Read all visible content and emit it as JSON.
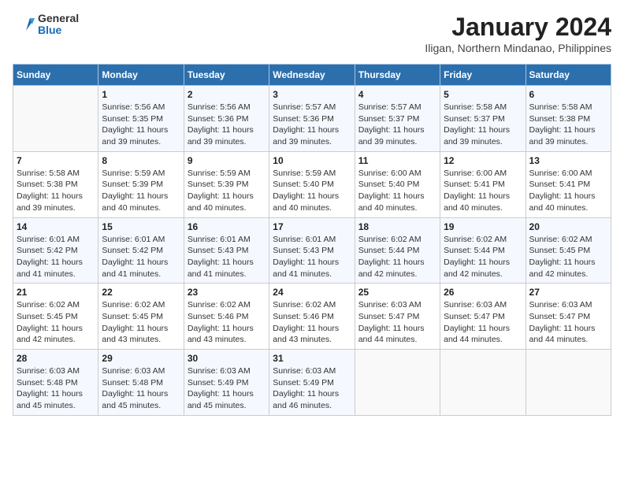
{
  "header": {
    "logo_general": "General",
    "logo_blue": "Blue",
    "month_title": "January 2024",
    "location": "Iligan, Northern Mindanao, Philippines"
  },
  "days_of_week": [
    "Sunday",
    "Monday",
    "Tuesday",
    "Wednesday",
    "Thursday",
    "Friday",
    "Saturday"
  ],
  "weeks": [
    [
      {
        "day": "",
        "sunrise": "",
        "sunset": "",
        "daylight": ""
      },
      {
        "day": "1",
        "sunrise": "Sunrise: 5:56 AM",
        "sunset": "Sunset: 5:35 PM",
        "daylight": "Daylight: 11 hours and 39 minutes."
      },
      {
        "day": "2",
        "sunrise": "Sunrise: 5:56 AM",
        "sunset": "Sunset: 5:36 PM",
        "daylight": "Daylight: 11 hours and 39 minutes."
      },
      {
        "day": "3",
        "sunrise": "Sunrise: 5:57 AM",
        "sunset": "Sunset: 5:36 PM",
        "daylight": "Daylight: 11 hours and 39 minutes."
      },
      {
        "day": "4",
        "sunrise": "Sunrise: 5:57 AM",
        "sunset": "Sunset: 5:37 PM",
        "daylight": "Daylight: 11 hours and 39 minutes."
      },
      {
        "day": "5",
        "sunrise": "Sunrise: 5:58 AM",
        "sunset": "Sunset: 5:37 PM",
        "daylight": "Daylight: 11 hours and 39 minutes."
      },
      {
        "day": "6",
        "sunrise": "Sunrise: 5:58 AM",
        "sunset": "Sunset: 5:38 PM",
        "daylight": "Daylight: 11 hours and 39 minutes."
      }
    ],
    [
      {
        "day": "7",
        "sunrise": "Sunrise: 5:58 AM",
        "sunset": "Sunset: 5:38 PM",
        "daylight": "Daylight: 11 hours and 39 minutes."
      },
      {
        "day": "8",
        "sunrise": "Sunrise: 5:59 AM",
        "sunset": "Sunset: 5:39 PM",
        "daylight": "Daylight: 11 hours and 40 minutes."
      },
      {
        "day": "9",
        "sunrise": "Sunrise: 5:59 AM",
        "sunset": "Sunset: 5:39 PM",
        "daylight": "Daylight: 11 hours and 40 minutes."
      },
      {
        "day": "10",
        "sunrise": "Sunrise: 5:59 AM",
        "sunset": "Sunset: 5:40 PM",
        "daylight": "Daylight: 11 hours and 40 minutes."
      },
      {
        "day": "11",
        "sunrise": "Sunrise: 6:00 AM",
        "sunset": "Sunset: 5:40 PM",
        "daylight": "Daylight: 11 hours and 40 minutes."
      },
      {
        "day": "12",
        "sunrise": "Sunrise: 6:00 AM",
        "sunset": "Sunset: 5:41 PM",
        "daylight": "Daylight: 11 hours and 40 minutes."
      },
      {
        "day": "13",
        "sunrise": "Sunrise: 6:00 AM",
        "sunset": "Sunset: 5:41 PM",
        "daylight": "Daylight: 11 hours and 40 minutes."
      }
    ],
    [
      {
        "day": "14",
        "sunrise": "Sunrise: 6:01 AM",
        "sunset": "Sunset: 5:42 PM",
        "daylight": "Daylight: 11 hours and 41 minutes."
      },
      {
        "day": "15",
        "sunrise": "Sunrise: 6:01 AM",
        "sunset": "Sunset: 5:42 PM",
        "daylight": "Daylight: 11 hours and 41 minutes."
      },
      {
        "day": "16",
        "sunrise": "Sunrise: 6:01 AM",
        "sunset": "Sunset: 5:43 PM",
        "daylight": "Daylight: 11 hours and 41 minutes."
      },
      {
        "day": "17",
        "sunrise": "Sunrise: 6:01 AM",
        "sunset": "Sunset: 5:43 PM",
        "daylight": "Daylight: 11 hours and 41 minutes."
      },
      {
        "day": "18",
        "sunrise": "Sunrise: 6:02 AM",
        "sunset": "Sunset: 5:44 PM",
        "daylight": "Daylight: 11 hours and 42 minutes."
      },
      {
        "day": "19",
        "sunrise": "Sunrise: 6:02 AM",
        "sunset": "Sunset: 5:44 PM",
        "daylight": "Daylight: 11 hours and 42 minutes."
      },
      {
        "day": "20",
        "sunrise": "Sunrise: 6:02 AM",
        "sunset": "Sunset: 5:45 PM",
        "daylight": "Daylight: 11 hours and 42 minutes."
      }
    ],
    [
      {
        "day": "21",
        "sunrise": "Sunrise: 6:02 AM",
        "sunset": "Sunset: 5:45 PM",
        "daylight": "Daylight: 11 hours and 42 minutes."
      },
      {
        "day": "22",
        "sunrise": "Sunrise: 6:02 AM",
        "sunset": "Sunset: 5:45 PM",
        "daylight": "Daylight: 11 hours and 43 minutes."
      },
      {
        "day": "23",
        "sunrise": "Sunrise: 6:02 AM",
        "sunset": "Sunset: 5:46 PM",
        "daylight": "Daylight: 11 hours and 43 minutes."
      },
      {
        "day": "24",
        "sunrise": "Sunrise: 6:02 AM",
        "sunset": "Sunset: 5:46 PM",
        "daylight": "Daylight: 11 hours and 43 minutes."
      },
      {
        "day": "25",
        "sunrise": "Sunrise: 6:03 AM",
        "sunset": "Sunset: 5:47 PM",
        "daylight": "Daylight: 11 hours and 44 minutes."
      },
      {
        "day": "26",
        "sunrise": "Sunrise: 6:03 AM",
        "sunset": "Sunset: 5:47 PM",
        "daylight": "Daylight: 11 hours and 44 minutes."
      },
      {
        "day": "27",
        "sunrise": "Sunrise: 6:03 AM",
        "sunset": "Sunset: 5:47 PM",
        "daylight": "Daylight: 11 hours and 44 minutes."
      }
    ],
    [
      {
        "day": "28",
        "sunrise": "Sunrise: 6:03 AM",
        "sunset": "Sunset: 5:48 PM",
        "daylight": "Daylight: 11 hours and 45 minutes."
      },
      {
        "day": "29",
        "sunrise": "Sunrise: 6:03 AM",
        "sunset": "Sunset: 5:48 PM",
        "daylight": "Daylight: 11 hours and 45 minutes."
      },
      {
        "day": "30",
        "sunrise": "Sunrise: 6:03 AM",
        "sunset": "Sunset: 5:49 PM",
        "daylight": "Daylight: 11 hours and 45 minutes."
      },
      {
        "day": "31",
        "sunrise": "Sunrise: 6:03 AM",
        "sunset": "Sunset: 5:49 PM",
        "daylight": "Daylight: 11 hours and 46 minutes."
      },
      {
        "day": "",
        "sunrise": "",
        "sunset": "",
        "daylight": ""
      },
      {
        "day": "",
        "sunrise": "",
        "sunset": "",
        "daylight": ""
      },
      {
        "day": "",
        "sunrise": "",
        "sunset": "",
        "daylight": ""
      }
    ]
  ]
}
